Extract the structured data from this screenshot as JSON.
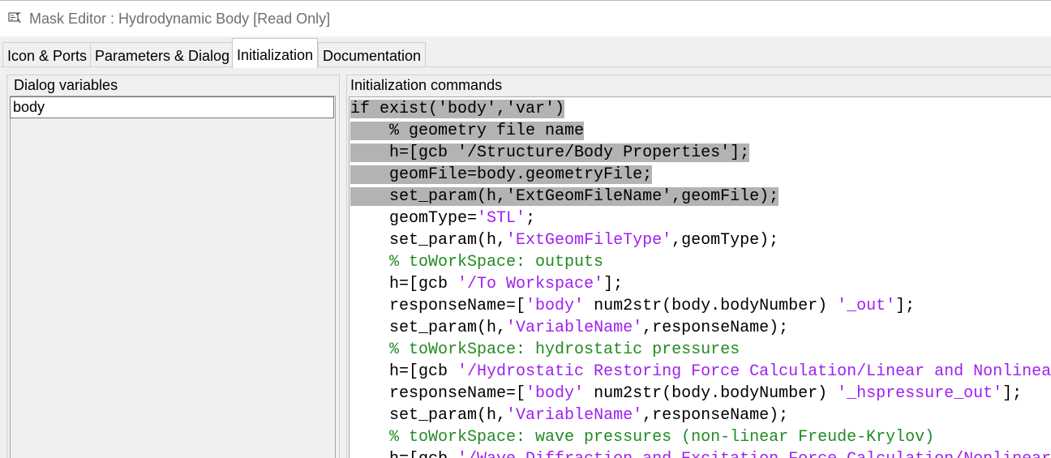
{
  "window": {
    "title": "Mask Editor : Hydrodynamic Body [Read Only]",
    "icon": "mask-editor-icon"
  },
  "tabs": [
    {
      "label": "Icon & Ports"
    },
    {
      "label": "Parameters & Dialog"
    },
    {
      "label": "Initialization",
      "active": true
    },
    {
      "label": "Documentation"
    }
  ],
  "dialog_variables": {
    "label": "Dialog variables",
    "items": [
      "body"
    ]
  },
  "init_commands": {
    "label": "Initialization commands",
    "lines": [
      {
        "indent": "",
        "tokens": [
          {
            "t": "if exist('body','var')",
            "c": "code"
          }
        ],
        "selected": true
      },
      {
        "indent": "    ",
        "tokens": [
          {
            "t": "% geometry file name",
            "c": "code"
          }
        ],
        "selected": true
      },
      {
        "indent": "    ",
        "tokens": [
          {
            "t": "h=[gcb '/Structure/Body Properties'];",
            "c": "code"
          }
        ],
        "selected": true
      },
      {
        "indent": "    ",
        "tokens": [
          {
            "t": "geomFile=body.geometryFile;",
            "c": "code"
          }
        ],
        "selected": true
      },
      {
        "indent": "    ",
        "tokens": [
          {
            "t": "set_param(h,'ExtGeomFileName',geomFile);",
            "c": "code"
          }
        ],
        "selected": true
      },
      {
        "indent": "    ",
        "tokens": [
          {
            "t": "geomType=",
            "c": "code"
          },
          {
            "t": "'STL'",
            "c": "str"
          },
          {
            "t": ";",
            "c": "code"
          }
        ]
      },
      {
        "indent": "    ",
        "tokens": [
          {
            "t": "set_param(h,",
            "c": "code"
          },
          {
            "t": "'ExtGeomFileType'",
            "c": "str"
          },
          {
            "t": ",geomType);",
            "c": "code"
          }
        ]
      },
      {
        "indent": "    ",
        "tokens": [
          {
            "t": "% toWorkSpace: outputs",
            "c": "cmt"
          }
        ]
      },
      {
        "indent": "    ",
        "tokens": [
          {
            "t": "h=[gcb ",
            "c": "code"
          },
          {
            "t": "'/To Workspace'",
            "c": "str"
          },
          {
            "t": "];",
            "c": "code"
          }
        ]
      },
      {
        "indent": "    ",
        "tokens": [
          {
            "t": "responseName=[",
            "c": "code"
          },
          {
            "t": "'body'",
            "c": "str"
          },
          {
            "t": " num2str(body.bodyNumber) ",
            "c": "code"
          },
          {
            "t": "'_out'",
            "c": "str"
          },
          {
            "t": "];",
            "c": "code"
          }
        ]
      },
      {
        "indent": "    ",
        "tokens": [
          {
            "t": "set_param(h,",
            "c": "code"
          },
          {
            "t": "'VariableName'",
            "c": "str"
          },
          {
            "t": ",responseName);",
            "c": "code"
          }
        ]
      },
      {
        "indent": "    ",
        "tokens": [
          {
            "t": "% toWorkSpace: hydrostatic pressures",
            "c": "cmt"
          }
        ]
      },
      {
        "indent": "    ",
        "tokens": [
          {
            "t": "h=[gcb ",
            "c": "code"
          },
          {
            "t": "'/Hydrostatic Restoring Force Calculation/Linear and Nonlinea",
            "c": "str"
          }
        ]
      },
      {
        "indent": "    ",
        "tokens": [
          {
            "t": "responseName=[",
            "c": "code"
          },
          {
            "t": "'body'",
            "c": "str"
          },
          {
            "t": " num2str(body.bodyNumber) ",
            "c": "code"
          },
          {
            "t": "'_hspressure_out'",
            "c": "str"
          },
          {
            "t": "];",
            "c": "code"
          }
        ]
      },
      {
        "indent": "    ",
        "tokens": [
          {
            "t": "set_param(h,",
            "c": "code"
          },
          {
            "t": "'VariableName'",
            "c": "str"
          },
          {
            "t": ",responseName);",
            "c": "code"
          }
        ]
      },
      {
        "indent": "    ",
        "tokens": [
          {
            "t": "% toWorkSpace: wave pressures (non-linear Freude-Krylov)",
            "c": "cmt"
          }
        ]
      },
      {
        "indent": "    ",
        "tokens": [
          {
            "t": "h=[gcb ",
            "c": "code"
          },
          {
            "t": "'/Wave Diffraction and Excitation Force Calculation/Nonlinear",
            "c": "str"
          }
        ]
      }
    ]
  },
  "colors": {
    "string": "#a020f0",
    "comment": "#228b22",
    "selection": "#b3b3b3"
  }
}
